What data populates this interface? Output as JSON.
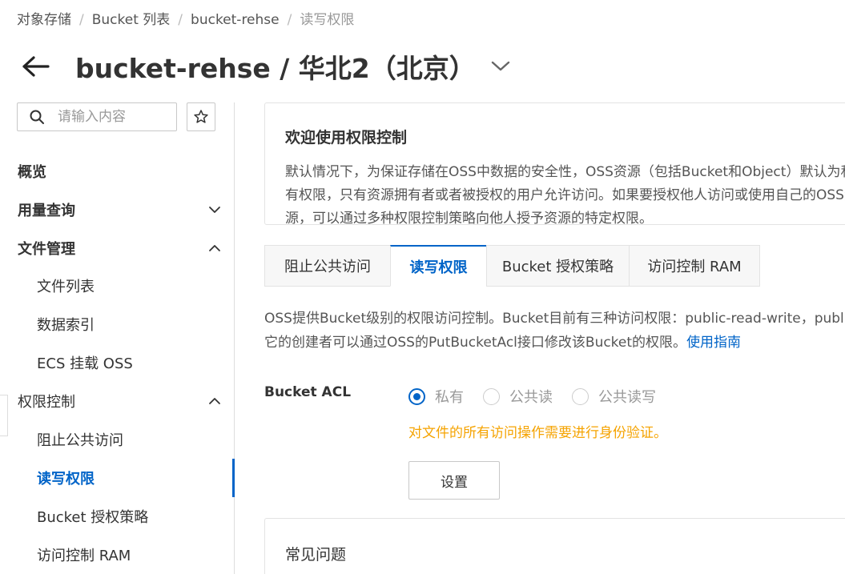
{
  "breadcrumb": {
    "items": [
      "对象存储",
      "Bucket 列表",
      "bucket-rehse",
      "读写权限"
    ],
    "separator": "/"
  },
  "header": {
    "title": "bucket-rehse / 华北2（北京）"
  },
  "sidebar": {
    "search_placeholder": "请输入内容",
    "items": [
      {
        "label": "概览"
      },
      {
        "label": "用量查询"
      },
      {
        "label": "文件管理"
      },
      {
        "label": "文件列表"
      },
      {
        "label": "数据索引"
      },
      {
        "label": "ECS 挂载 OSS"
      },
      {
        "label": "权限控制"
      },
      {
        "label": "阻止公共访问"
      },
      {
        "label": "读写权限"
      },
      {
        "label": "Bucket 授权策略"
      },
      {
        "label": "访问控制 RAM"
      }
    ]
  },
  "welcome": {
    "title": "欢迎使用权限控制",
    "text": "默认情况下，为保证存储在OSS中数据的安全性，OSS资源（包括Bucket和Object）默认为私有权限，只有资源拥有者或者被授权的用户允许访问。如果要授权他人访问或使用自己的OSS资源，可以通过多种权限控制策略向他人授予资源的特定权限。"
  },
  "tabs": [
    {
      "label": "阻止公共访问"
    },
    {
      "label": "读写权限"
    },
    {
      "label": "Bucket 授权策略"
    },
    {
      "label": "访问控制 RAM"
    }
  ],
  "description": {
    "line1": "OSS提供Bucket级别的权限访问控制。Bucket目前有三种访问权限：public-read-write，public-read和private",
    "line2": "它的创建者可以通过OSS的PutBucketAcl接口修改该Bucket的权限。",
    "link": "使用指南"
  },
  "acl": {
    "label": "Bucket ACL",
    "options": [
      {
        "label": "私有",
        "selected": true
      },
      {
        "label": "公共读",
        "selected": false
      },
      {
        "label": "公共读写",
        "selected": false
      }
    ],
    "hint": "对文件的所有访问操作需要进行身份验证。",
    "button": "设置"
  },
  "faq": {
    "title": "常见问题"
  },
  "colors": {
    "accent": "#0064c8",
    "warning": "#f5a300"
  }
}
